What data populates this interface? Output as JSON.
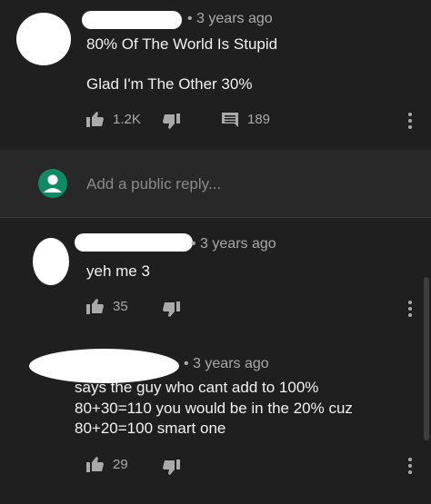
{
  "comments": [
    {
      "time": "• 3 years ago",
      "lines": [
        "80% Of The World Is Stupid",
        "Glad I'm The Other 30%"
      ],
      "likes": "1.2K",
      "replies": "189"
    },
    {
      "time": "• 3 years ago",
      "lines": [
        "yeh me 3"
      ],
      "likes": "35"
    },
    {
      "time": "• 3 years ago",
      "lines": [
        "says the guy who cant add to 100%",
        "80+30=110 you would be in the 20% cuz",
        "80+20=100 smart one"
      ],
      "likes": "29"
    }
  ],
  "reply_input": {
    "placeholder": "Add a public reply..."
  },
  "icons": {
    "like": "thumbs-up-icon",
    "dislike": "thumbs-down-icon",
    "replies": "comment-icon",
    "menu": "more-vert-icon",
    "avatar": "account-avatar-icon"
  },
  "colors": {
    "background": "#1f1f1f",
    "reply_bar": "#282828",
    "avatar_green": "#0f8a65"
  }
}
